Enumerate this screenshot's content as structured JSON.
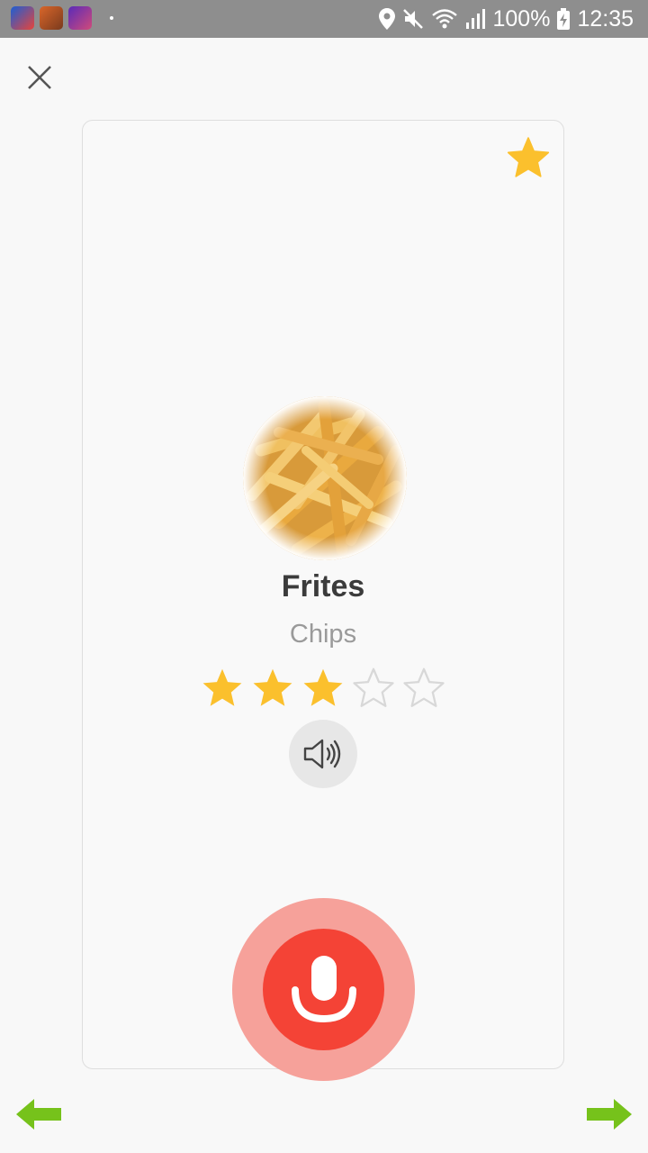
{
  "status_bar": {
    "battery": "100%",
    "time": "12:35",
    "icons": [
      "location-icon",
      "mute-icon",
      "wifi-icon",
      "signal-icon",
      "battery-charging-icon"
    ]
  },
  "top_bar": {
    "close_icon": "close-icon"
  },
  "card": {
    "favorite_icon": "star-filled-icon",
    "word": "Frites",
    "translation": "Chips",
    "rating": {
      "value": 3,
      "max": 5
    },
    "speaker_icon": "speaker-icon"
  },
  "record": {
    "icon": "microphone-icon"
  },
  "navigation": {
    "prev_icon": "arrow-left-icon",
    "next_icon": "arrow-right-icon"
  },
  "colors": {
    "accent_star": "#fbc02d",
    "mic_red": "#f44336",
    "mic_halo": "#f6a19a",
    "nav_green": "#76c21b"
  }
}
